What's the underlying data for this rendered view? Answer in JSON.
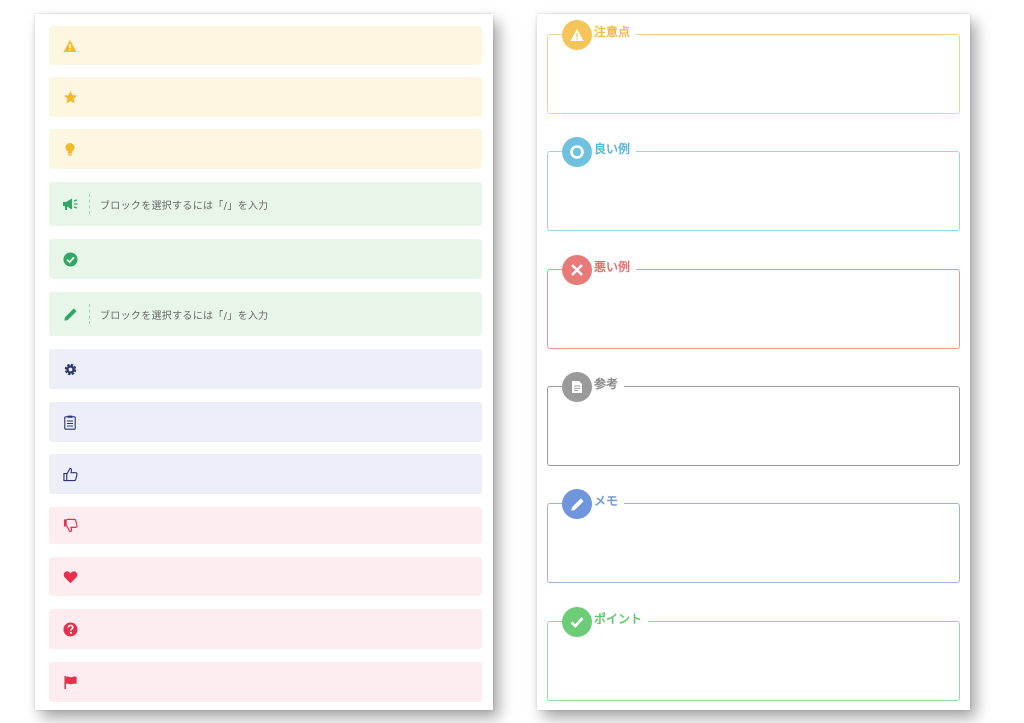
{
  "colors": {
    "yellow_bg": "#fdf7e1",
    "yellow_icon": "#f2b92a",
    "green_bg": "#e8f6e9",
    "green_icon": "#2fa866",
    "blue_bg": "#eceff8",
    "blue_icon": "#2c3570",
    "red_bg": "#fdedf0",
    "red_icon": "#e8304e"
  },
  "left_blocks": [
    {
      "icon": "warning-icon",
      "placeholder": ""
    },
    {
      "icon": "star-icon",
      "placeholder": ""
    },
    {
      "icon": "lightbulb-icon",
      "placeholder": ""
    },
    {
      "icon": "megaphone-icon",
      "placeholder": "ブロックを選択するには「/」を入力"
    },
    {
      "icon": "check-circle-icon",
      "placeholder": ""
    },
    {
      "icon": "pencil-icon",
      "placeholder": "ブロックを選択するには「/」を入力"
    },
    {
      "icon": "gear-icon",
      "placeholder": ""
    },
    {
      "icon": "clipboard-icon",
      "placeholder": ""
    },
    {
      "icon": "thumbs-up-icon",
      "placeholder": ""
    },
    {
      "icon": "thumbs-down-icon",
      "placeholder": ""
    },
    {
      "icon": "heart-icon",
      "placeholder": ""
    },
    {
      "icon": "question-circle-icon",
      "placeholder": ""
    },
    {
      "icon": "flag-icon",
      "placeholder": ""
    }
  ],
  "right_boxes": [
    {
      "label": "注意点",
      "icon": "warning-icon",
      "color": "#f5c55a",
      "border": "#f2d58a"
    },
    {
      "label": "良い例",
      "icon": "circle-icon",
      "color": "#6ec2e0",
      "border": "#9fd2e6"
    },
    {
      "label": "悪い例",
      "icon": "close-icon",
      "color": "#e87a7a",
      "border": "#e89a90"
    },
    {
      "label": "参考",
      "icon": "document-icon",
      "color": "#9a9a9a",
      "border": "#9a9a9a"
    },
    {
      "label": "メモ",
      "icon": "pencil-icon",
      "color": "#6f95dc",
      "border": "#9cb3d8"
    },
    {
      "label": "ポイント",
      "icon": "check-icon",
      "color": "#6dcc78",
      "border": "#9ad89f"
    }
  ]
}
